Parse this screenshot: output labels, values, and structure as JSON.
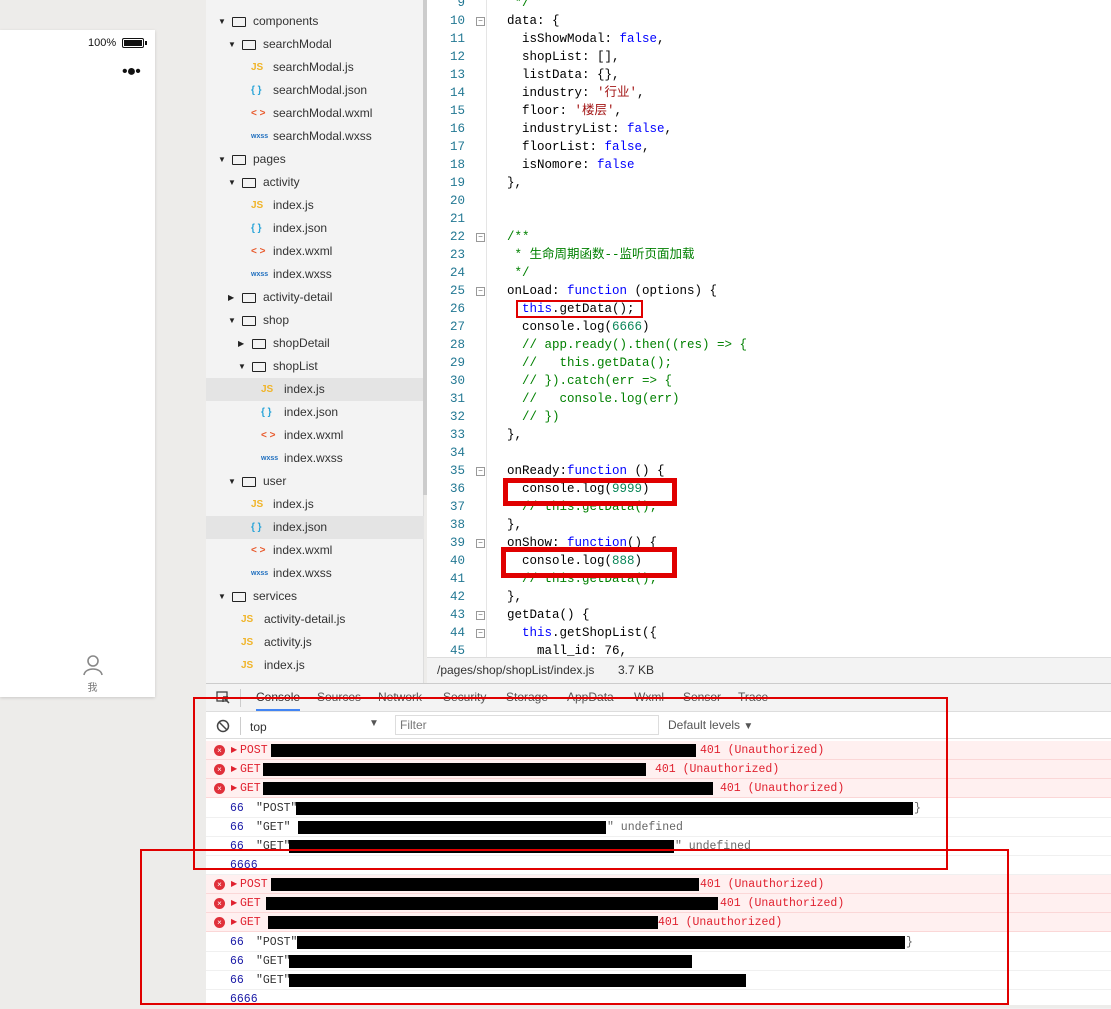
{
  "simulator": {
    "battery_percent": "100%",
    "more_icon": "•●•",
    "tab_me_label": "我"
  },
  "file_tree": [
    {
      "label": "components",
      "type": "folder",
      "level": 0,
      "open": true
    },
    {
      "label": "searchModal",
      "type": "folder",
      "level": 1,
      "open": true
    },
    {
      "label": "searchModal.js",
      "type": "js",
      "level": 2
    },
    {
      "label": "searchModal.json",
      "type": "json",
      "level": 2
    },
    {
      "label": "searchModal.wxml",
      "type": "wxml",
      "level": 2
    },
    {
      "label": "searchModal.wxss",
      "type": "wxss",
      "level": 2
    },
    {
      "label": "pages",
      "type": "folder",
      "level": 0,
      "open": true
    },
    {
      "label": "activity",
      "type": "folder",
      "level": 1,
      "open": true
    },
    {
      "label": "index.js",
      "type": "js",
      "level": 2
    },
    {
      "label": "index.json",
      "type": "json",
      "level": 2
    },
    {
      "label": "index.wxml",
      "type": "wxml",
      "level": 2
    },
    {
      "label": "index.wxss",
      "type": "wxss",
      "level": 2
    },
    {
      "label": "activity-detail",
      "type": "folder",
      "level": 1,
      "open": false
    },
    {
      "label": "shop",
      "type": "folder",
      "level": 1,
      "open": true
    },
    {
      "label": "shopDetail",
      "type": "folder",
      "level": 2,
      "open": false
    },
    {
      "label": "shopList",
      "type": "folder",
      "level": 2,
      "open": true
    },
    {
      "label": "index.js",
      "type": "js",
      "level": 3,
      "selected": true
    },
    {
      "label": "index.json",
      "type": "json",
      "level": 3
    },
    {
      "label": "index.wxml",
      "type": "wxml",
      "level": 3
    },
    {
      "label": "index.wxss",
      "type": "wxss",
      "level": 3
    },
    {
      "label": "user",
      "type": "folder",
      "level": 1,
      "open": true
    },
    {
      "label": "index.js",
      "type": "js",
      "level": 2
    },
    {
      "label": "index.json",
      "type": "json",
      "level": 2,
      "selected": true
    },
    {
      "label": "index.wxml",
      "type": "wxml",
      "level": 2
    },
    {
      "label": "index.wxss",
      "type": "wxss",
      "level": 2
    },
    {
      "label": "services",
      "type": "folder",
      "level": 0,
      "open": true
    },
    {
      "label": "activity-detail.js",
      "type": "js",
      "level": 1
    },
    {
      "label": "activity.js",
      "type": "js",
      "level": 1
    },
    {
      "label": "index.js",
      "type": "js",
      "level": 1
    }
  ],
  "file_icons": {
    "js": "JS",
    "json": "{ }",
    "wxml": "< >",
    "wxss": "wxss"
  },
  "editor": {
    "lines": [
      {
        "n": "9",
        "t": [
          [
            " */",
            "c"
          ]
        ]
      },
      {
        "n": "10",
        "f": true,
        "t": [
          [
            "data: {",
            "p"
          ]
        ]
      },
      {
        "n": "11",
        "t": [
          [
            "  isShowModal: ",
            "p"
          ],
          [
            "false",
            "k"
          ],
          [
            ",",
            "p"
          ]
        ]
      },
      {
        "n": "12",
        "t": [
          [
            "  shopList: [],",
            "p"
          ]
        ]
      },
      {
        "n": "13",
        "t": [
          [
            "  listData: {},",
            "p"
          ]
        ]
      },
      {
        "n": "14",
        "t": [
          [
            "  industry: ",
            "p"
          ],
          [
            "'行业'",
            "s"
          ],
          [
            ",",
            "p"
          ]
        ]
      },
      {
        "n": "15",
        "t": [
          [
            "  floor: ",
            "p"
          ],
          [
            "'楼层'",
            "s"
          ],
          [
            ",",
            "p"
          ]
        ]
      },
      {
        "n": "16",
        "t": [
          [
            "  industryList: ",
            "p"
          ],
          [
            "false",
            "k"
          ],
          [
            ",",
            "p"
          ]
        ]
      },
      {
        "n": "17",
        "t": [
          [
            "  floorList: ",
            "p"
          ],
          [
            "false",
            "k"
          ],
          [
            ",",
            "p"
          ]
        ]
      },
      {
        "n": "18",
        "t": [
          [
            "  isNomore: ",
            "p"
          ],
          [
            "false",
            "k"
          ]
        ]
      },
      {
        "n": "19",
        "t": [
          [
            "},",
            "p"
          ]
        ]
      },
      {
        "n": "20",
        "t": []
      },
      {
        "n": "21",
        "t": []
      },
      {
        "n": "22",
        "f": true,
        "t": [
          [
            "/**",
            "c"
          ]
        ]
      },
      {
        "n": "23",
        "t": [
          [
            " * 生命周期函数--监听页面加载",
            "c"
          ]
        ]
      },
      {
        "n": "24",
        "t": [
          [
            " */",
            "c"
          ]
        ]
      },
      {
        "n": "25",
        "f": true,
        "t": [
          [
            "onLoad: ",
            "p"
          ],
          [
            "function",
            "k"
          ],
          [
            " (options) {",
            "p"
          ]
        ]
      },
      {
        "n": "26",
        "t": [
          [
            "  ",
            "p"
          ],
          [
            "this",
            "k"
          ],
          [
            ".getData();",
            "p"
          ]
        ]
      },
      {
        "n": "27",
        "t": [
          [
            "  console.log(",
            "p"
          ],
          [
            "6666",
            "n"
          ],
          [
            ")",
            "p"
          ]
        ]
      },
      {
        "n": "28",
        "t": [
          [
            "  // app.ready().then((res) => {",
            "c"
          ]
        ]
      },
      {
        "n": "29",
        "t": [
          [
            "  //   this.getData();",
            "c"
          ]
        ]
      },
      {
        "n": "30",
        "t": [
          [
            "  // }).catch(err => {",
            "c"
          ]
        ]
      },
      {
        "n": "31",
        "t": [
          [
            "  //   console.log(err)",
            "c"
          ]
        ]
      },
      {
        "n": "32",
        "t": [
          [
            "  // })",
            "c"
          ]
        ]
      },
      {
        "n": "33",
        "t": [
          [
            "},",
            "p"
          ]
        ]
      },
      {
        "n": "34",
        "t": []
      },
      {
        "n": "35",
        "f": true,
        "t": [
          [
            "onReady:",
            "p"
          ],
          [
            "function",
            "k"
          ],
          [
            " () {",
            "p"
          ]
        ]
      },
      {
        "n": "36",
        "t": [
          [
            "  console.log(",
            "p"
          ],
          [
            "9999",
            "n"
          ],
          [
            ")",
            "p"
          ]
        ]
      },
      {
        "n": "37",
        "t": [
          [
            "  // this.getData();",
            "c"
          ]
        ]
      },
      {
        "n": "38",
        "t": [
          [
            "},",
            "p"
          ]
        ]
      },
      {
        "n": "39",
        "f": true,
        "t": [
          [
            "onShow: ",
            "p"
          ],
          [
            "function",
            "k"
          ],
          [
            "() {",
            "p"
          ]
        ]
      },
      {
        "n": "40",
        "t": [
          [
            "  console.log(",
            "p"
          ],
          [
            "888",
            "n"
          ],
          [
            ")",
            "p"
          ]
        ]
      },
      {
        "n": "41",
        "t": [
          [
            "  // this.getData();",
            "c"
          ]
        ]
      },
      {
        "n": "42",
        "t": [
          [
            "},",
            "p"
          ]
        ]
      },
      {
        "n": "43",
        "f": true,
        "t": [
          [
            "getData() {",
            "p"
          ]
        ]
      },
      {
        "n": "44",
        "f": true,
        "t": [
          [
            "  ",
            "p"
          ],
          [
            "this",
            "k"
          ],
          [
            ".getShopList({",
            "p"
          ]
        ]
      },
      {
        "n": "45",
        "t": [
          [
            "    mall_id: 76,",
            "p"
          ]
        ]
      }
    ]
  },
  "status_bar": {
    "path": "/pages/shop/shopList/index.js",
    "size": "3.7 KB"
  },
  "devtools": {
    "tabs": [
      "Console",
      "Sources",
      "Network",
      "Security",
      "Storage",
      "AppData",
      "Wxml",
      "Sensor",
      "Trace"
    ],
    "active_tab": "Console",
    "context": "top",
    "filter_placeholder": "Filter",
    "levels": "Default levels",
    "messages": [
      {
        "kind": "err",
        "method": "POST",
        "status": "401 (Unauthorized)"
      },
      {
        "kind": "err",
        "method": "GET",
        "status": "401 (Unauthorized)"
      },
      {
        "kind": "err",
        "method": "GET",
        "status": "401 (Unauthorized)"
      },
      {
        "kind": "log",
        "prefix": "66",
        "method": "\"POST\"",
        "tail": "}"
      },
      {
        "kind": "log",
        "prefix": "66",
        "method": "\"GET\" \"",
        "tail": "\" undefined"
      },
      {
        "kind": "log",
        "prefix": "66",
        "method": "\"GET\"",
        "tail": "\" undefined"
      },
      {
        "kind": "num",
        "text": "6666"
      },
      {
        "kind": "err",
        "method": "POST",
        "status": "401 (Unauthorized)"
      },
      {
        "kind": "err",
        "method": "GET",
        "status": "401 (Unauthorized)"
      },
      {
        "kind": "err",
        "method": "GET",
        "status": "401 (Unauthorized)"
      },
      {
        "kind": "log",
        "prefix": "66",
        "method": "\"POST\"",
        "tail": "}"
      },
      {
        "kind": "log",
        "prefix": "66",
        "method": "\"GET\"",
        "tail": ""
      },
      {
        "kind": "log",
        "prefix": "66",
        "method": "\"GET\"",
        "tail": ""
      },
      {
        "kind": "num",
        "text": "6666"
      }
    ]
  },
  "colors": {
    "annotation_red": "#e00000",
    "error_bg": "#fff0f0",
    "error_text": "#e0212f"
  }
}
